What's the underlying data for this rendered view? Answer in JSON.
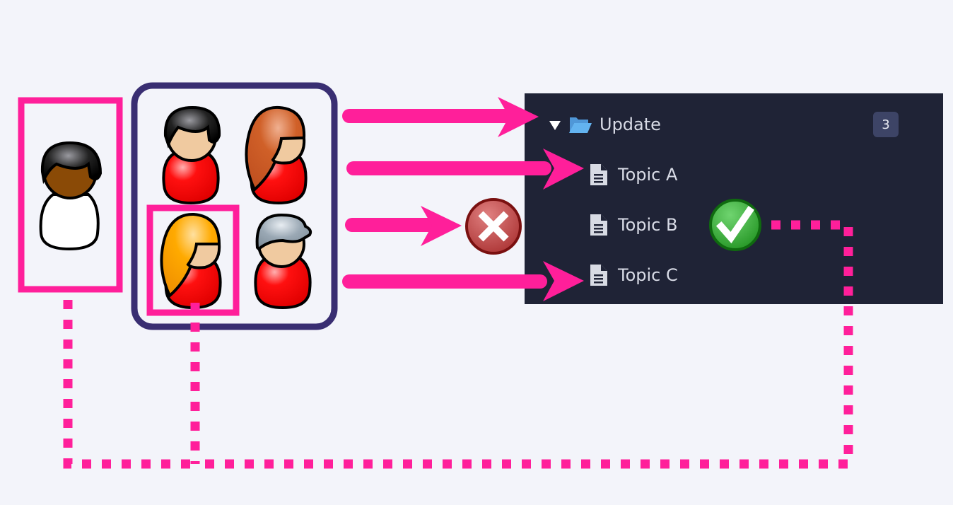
{
  "tree": {
    "folder": {
      "label": "Update",
      "count": "3",
      "expanded": true
    },
    "items": [
      {
        "label": "Topic A"
      },
      {
        "label": "Topic B"
      },
      {
        "label": "Topic C"
      }
    ]
  },
  "users": {
    "single": {
      "role": "individual",
      "shirt": "white",
      "skin": "dark brown"
    },
    "group": [
      {
        "role": "member-1",
        "hair": "black"
      },
      {
        "role": "member-2",
        "hair": "auburn long"
      },
      {
        "role": "member-3",
        "hair": "blonde long",
        "highlighted": true
      },
      {
        "role": "member-4",
        "hair": "grey cap"
      }
    ]
  },
  "status": {
    "denied_icon": "x-circle-icon",
    "approved_icon": "check-circle-icon"
  },
  "colors": {
    "accent": "#ff1f9a",
    "group_border": "#392e72",
    "panel_bg": "#1f2336",
    "badge_bg": "#3d4466",
    "folder": "#5aa8ea",
    "ok": "#3aa63a",
    "error": "#b84848"
  }
}
